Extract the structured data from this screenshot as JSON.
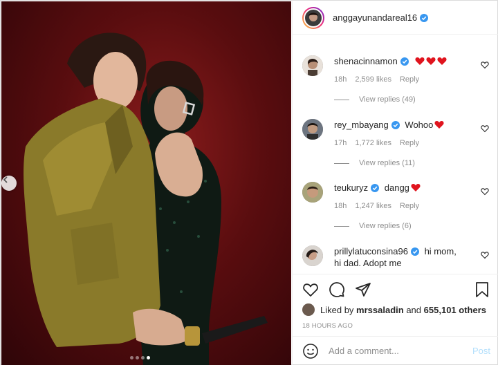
{
  "post": {
    "author": "anggayunandareal16",
    "carousel": {
      "dots": 4,
      "active_index": 3
    }
  },
  "comments": [
    {
      "user": "shenacinnamon",
      "text": "",
      "emoji": [
        "heart",
        "heart",
        "heart"
      ],
      "time": "18h",
      "likes": "2,599 likes",
      "reply": "Reply",
      "view_replies": "View replies (49)"
    },
    {
      "user": "rey_mbayang",
      "text": "Wohoo",
      "emoji": [
        "heart"
      ],
      "time": "17h",
      "likes": "1,772 likes",
      "reply": "Reply",
      "view_replies": "View replies (11)"
    },
    {
      "user": "teukuryz",
      "text": "dangg",
      "emoji": [
        "heart"
      ],
      "time": "18h",
      "likes": "1,247 likes",
      "reply": "Reply",
      "view_replies": "View replies (6)"
    },
    {
      "user": "prillylatuconsina96",
      "text_line1": "hi mom,",
      "text_line2": "hi dad. Adopt me"
    }
  ],
  "actions": {
    "liked_by_prefix": "Liked by",
    "liked_by_user": "mrssaladin",
    "liked_by_and": "and",
    "liked_by_others": "655,101 others",
    "time_ago": "18 HOURS AGO"
  },
  "add_comment": {
    "placeholder": "Add a comment...",
    "post_label": "Post"
  },
  "icons": {
    "verified": "verified-badge-icon",
    "like": "heart-outline-icon",
    "comment": "comment-bubble-icon",
    "share": "paper-plane-icon",
    "save": "bookmark-icon",
    "emoji": "smiley-icon",
    "prev": "chevron-left-icon"
  },
  "colors": {
    "verified_blue": "#3897f0",
    "heart_red": "#ed4956",
    "post_disabled": "#b2dffc",
    "muted": "#8e8e8e"
  }
}
